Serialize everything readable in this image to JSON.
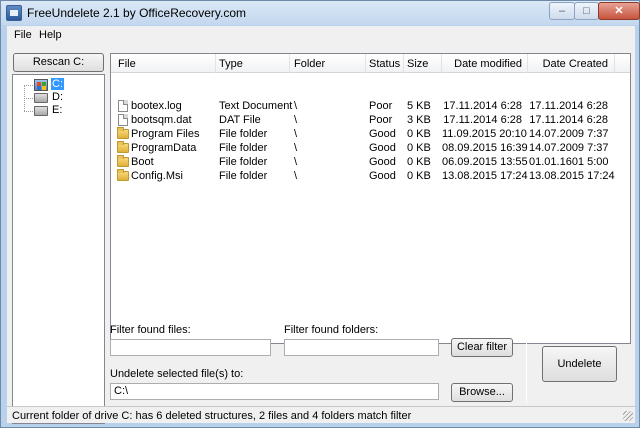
{
  "window": {
    "title": "FreeUndelete 2.1 by OfficeRecovery.com"
  },
  "menu": {
    "file": "File",
    "help": "Help"
  },
  "left": {
    "rescan_label": "Rescan C:",
    "drives": [
      {
        "label": "C:",
        "selected": true
      },
      {
        "label": "D:",
        "selected": false
      },
      {
        "label": "E:",
        "selected": false
      }
    ]
  },
  "list": {
    "columns": [
      "File",
      "Type",
      "Folder",
      "Status",
      "Size",
      "Date modified",
      "Date Created"
    ],
    "rows": [
      {
        "icon": "file-icon",
        "file": "bootex.log",
        "type": "Text Document",
        "folder": "\\",
        "status": "Poor",
        "size": "5 KB",
        "modified": "17.11.2014  6:28",
        "created": "17.11.2014  6:28"
      },
      {
        "icon": "file-icon",
        "file": "bootsqm.dat",
        "type": "DAT File",
        "folder": "\\",
        "status": "Poor",
        "size": "3 KB",
        "modified": "17.11.2014  6:28",
        "created": "17.11.2014  6:28"
      },
      {
        "icon": "folder-icon",
        "file": "Program Files",
        "type": "File folder",
        "folder": "\\",
        "status": "Good",
        "size": "0 KB",
        "modified": "11.09.2015 20:10",
        "created": "14.07.2009  7:37"
      },
      {
        "icon": "folder-icon",
        "file": "ProgramData",
        "type": "File folder",
        "folder": "\\",
        "status": "Good",
        "size": "0 KB",
        "modified": "08.09.2015 16:39",
        "created": "14.07.2009  7:37"
      },
      {
        "icon": "folder-icon",
        "file": "Boot",
        "type": "File folder",
        "folder": "\\",
        "status": "Good",
        "size": "0 KB",
        "modified": "06.09.2015 13:55",
        "created": "01.01.1601  5:00"
      },
      {
        "icon": "folder-icon",
        "file": "Config.Msi",
        "type": "File folder",
        "folder": "\\",
        "status": "Good",
        "size": "0 KB",
        "modified": "13.08.2015 17:24",
        "created": "13.08.2015 17:24"
      }
    ]
  },
  "filters": {
    "files_label": "Filter found files:",
    "files_value": "",
    "folders_label": "Filter found folders:",
    "folders_value": "",
    "clear_label": "Clear filter"
  },
  "undelete": {
    "label": "Undelete selected file(s) to:",
    "path": "C:\\",
    "browse_label": "Browse...",
    "button_label": "Undelete"
  },
  "status": "Current folder of drive C: has 6 deleted structures, 2 files and 4 folders match filter"
}
